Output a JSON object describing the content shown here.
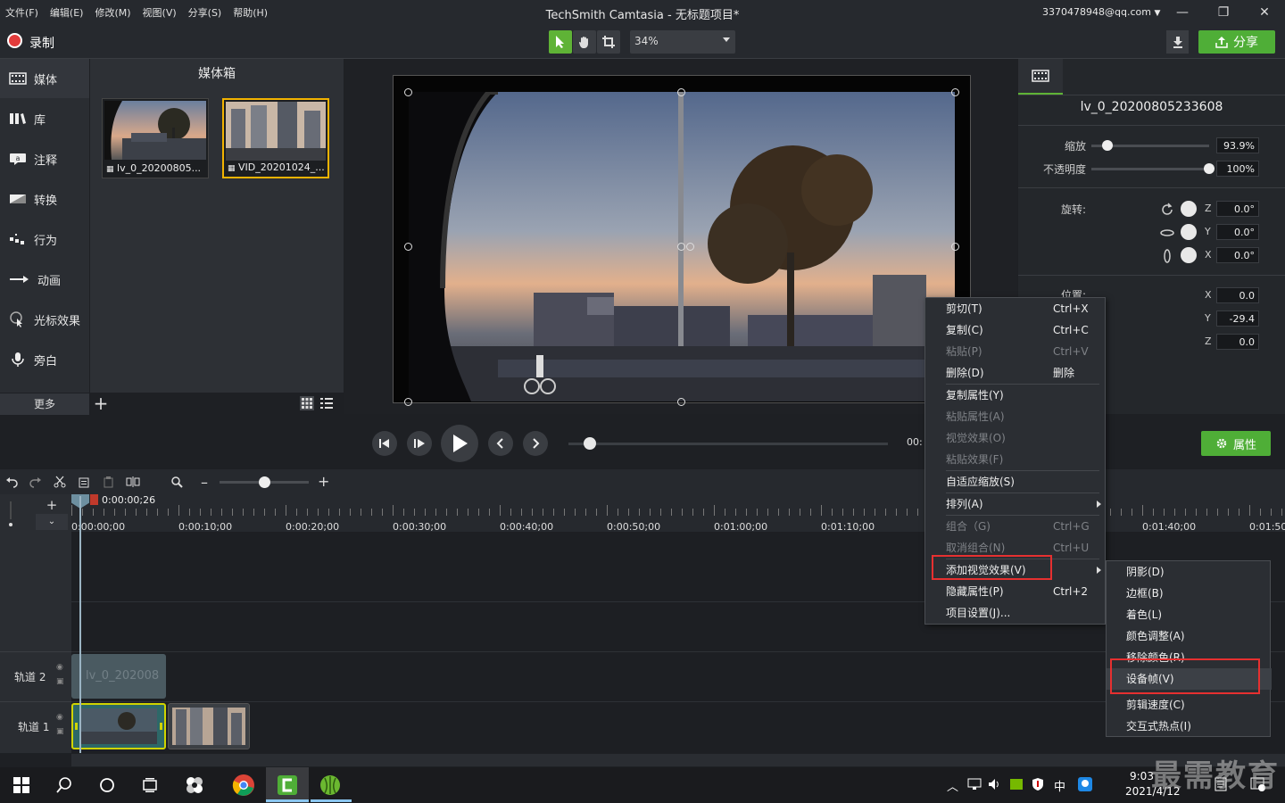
{
  "menu": [
    "文件(F)",
    "编辑(E)",
    "修改(M)",
    "视图(V)",
    "分享(S)",
    "帮助(H)"
  ],
  "app_title": "TechSmith Camtasia - 无标题项目*",
  "account": "3370478948@qq.com",
  "toolbar": {
    "record_label": "录制",
    "zoom": "34%",
    "share_label": "分享"
  },
  "sidebar": {
    "items": [
      {
        "label": "媒体",
        "icon": "film-icon"
      },
      {
        "label": "库",
        "icon": "library-icon"
      },
      {
        "label": "注释",
        "icon": "annotation-icon"
      },
      {
        "label": "转换",
        "icon": "transition-icon"
      },
      {
        "label": "行为",
        "icon": "behavior-icon"
      },
      {
        "label": "动画",
        "icon": "animation-icon"
      },
      {
        "label": "光标效果",
        "icon": "cursor-icon"
      },
      {
        "label": "旁白",
        "icon": "microphone-icon"
      }
    ],
    "more_label": "更多"
  },
  "mediabin": {
    "title": "媒体箱",
    "items": [
      {
        "caption": "lv_0_20200805..."
      },
      {
        "caption": "VID_20201024_..."
      }
    ]
  },
  "playback": {
    "time": "00:"
  },
  "properties": {
    "clip_name": "lv_0_20200805233608",
    "scale_label": "缩放",
    "scale_value": "93.9%",
    "scale_level": 0.14,
    "opacity_label": "不透明度",
    "opacity_value": "100%",
    "opacity_level": 1.0,
    "rotation_label": "旋转:",
    "rotation": [
      {
        "axis": "Z",
        "value": "0.0°"
      },
      {
        "axis": "Y",
        "value": "0.0°"
      },
      {
        "axis": "X",
        "value": "0.0°"
      }
    ],
    "position_label": "位置:",
    "position": [
      {
        "axis": "X",
        "value": "0.0"
      },
      {
        "axis": "Y",
        "value": "-29.4"
      },
      {
        "axis": "Z",
        "value": "0.0"
      }
    ],
    "props_button": "属性"
  },
  "timeline": {
    "playhead_time": "0:00:00;26",
    "ticks": [
      "0:00:00;00",
      "0:00:10;00",
      "0:00:20;00",
      "0:00:30;00",
      "0:00:40;00",
      "0:00:50;00",
      "0:01:00;00",
      "0:01:10;00",
      "0:01:40;00",
      "0:01:50;"
    ],
    "tracks": [
      {
        "label": "轨道 2",
        "clip": "lv_0_202008"
      },
      {
        "label": "轨道 1"
      }
    ]
  },
  "context_menu": [
    {
      "label": "剪切(T)",
      "shortcut": "Ctrl+X",
      "enabled": true
    },
    {
      "label": "复制(C)",
      "shortcut": "Ctrl+C",
      "enabled": true
    },
    {
      "label": "粘贴(P)",
      "shortcut": "Ctrl+V",
      "enabled": false
    },
    {
      "label": "删除(D)",
      "shortcut": "删除",
      "enabled": true
    },
    {
      "label": "复制属性(Y)",
      "shortcut": "",
      "enabled": true
    },
    {
      "label": "粘贴属性(A)",
      "shortcut": "",
      "enabled": false
    },
    {
      "label": "视觉效果(O)",
      "shortcut": "",
      "enabled": false
    },
    {
      "label": "粘贴效果(F)",
      "shortcut": "",
      "enabled": false
    },
    {
      "label": "自适应缩放(S)",
      "shortcut": "",
      "enabled": true
    },
    {
      "label": "排列(A)",
      "shortcut": "",
      "enabled": true
    },
    {
      "label": "组合（G)",
      "shortcut": "Ctrl+G",
      "enabled": false
    },
    {
      "label": "取消组合(N)",
      "shortcut": "Ctrl+U",
      "enabled": false
    },
    {
      "label": "添加视觉效果(V)",
      "shortcut": "",
      "enabled": true
    },
    {
      "label": "隐藏属性(P)",
      "shortcut": "Ctrl+2",
      "enabled": true
    },
    {
      "label": "项目设置(J)...",
      "shortcut": "",
      "enabled": true
    }
  ],
  "submenu": [
    "阴影(D)",
    "边框(B)",
    "着色(L)",
    "颜色调整(A)",
    "移除颜色(R)",
    "设备帧(V)",
    "剪辑速度(C)",
    "交互式热点(I)"
  ],
  "taskbar": {
    "time": "9:03",
    "date": "2021/4/12",
    "ime": "中"
  },
  "watermark": "最需教育",
  "colors": {
    "accent_green": "#4fae37",
    "highlight_red": "#e63030",
    "selected_thumb": "#f2b300"
  }
}
